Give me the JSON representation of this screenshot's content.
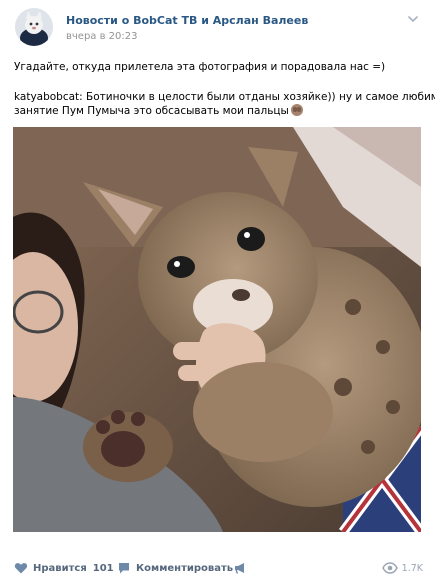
{
  "post": {
    "author": "Новости о BobCat ТВ и Арслан Валеев",
    "time": "вчера в 20:23",
    "text_line_1": "Угадайте, откуда прилетела эта фотография и порадовала нас =)",
    "text_line_2": "katyabobcat: Ботиночки в целости были отданы хозяйке)) ну и самое любимое",
    "text_line_3": "занятие Пум Пумыча это обсасывать мои пальцы"
  },
  "icons": {
    "avatar": "bobcat-avatar",
    "more": "chevron-down-icon",
    "emoji": "see-no-evil-monkey-emoji",
    "like": "heart-icon",
    "comment": "speech-bubble-icon",
    "share": "megaphone-icon",
    "views": "eye-icon"
  },
  "actions": {
    "like_label": "Нравится",
    "like_count": "101",
    "comment_label": "Комментировать",
    "views_count": "1.7K"
  },
  "colors": {
    "author_link": "#2a5885",
    "action_text": "#55677d",
    "muted": "#939393"
  }
}
